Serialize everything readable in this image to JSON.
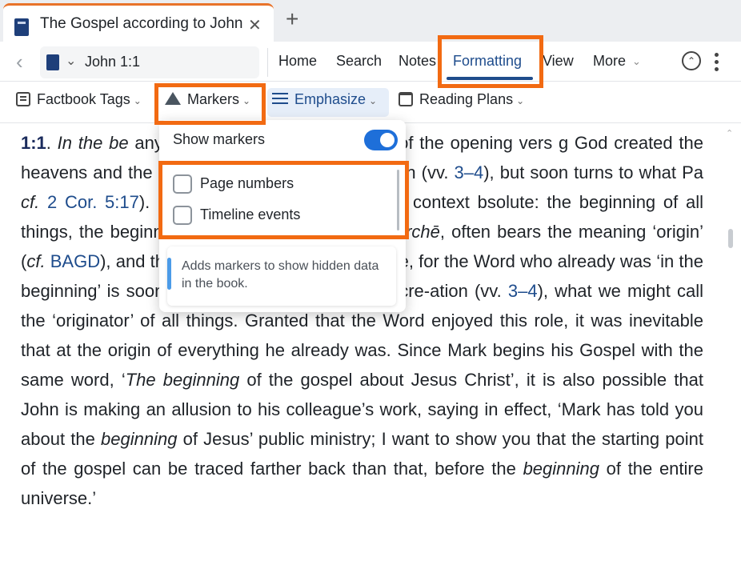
{
  "tab": {
    "title": "The Gospel according to John",
    "close": "✕",
    "add": "+"
  },
  "nav": {
    "back": "‹",
    "reference": "John 1:1",
    "menu": [
      "Home",
      "Search",
      "Notes",
      "Formatting",
      "View",
      "More"
    ],
    "active_menu": "Formatting"
  },
  "toolbar": {
    "factbook": "Factbook Tags",
    "markers": "Markers",
    "emphasize": "Emphasize",
    "reading_plans": "Reading Plans",
    "chevron": "⌄"
  },
  "dropdown": {
    "show_markers_label": "Show markers",
    "show_markers_on": true,
    "options": [
      {
        "label": "Page numbers",
        "checked": false
      },
      {
        "label": "Timeline events",
        "checked": false
      }
    ],
    "hint": "Adds markers to show hidden data in the book."
  },
  "body": {
    "verse": "1:1",
    "segments": [
      [
        ". ",
        "t"
      ],
      [
        "In the be",
        "i"
      ],
      [
        "                              any reader of the Old Testament of the opening vers                              g God created the heavens and the earth.’ Genesis b                             fers to creation (vv. ",
        "t"
      ],
      [
        "3–4",
        "l"
      ],
      [
        "), but soon turns to what Pa                          ",
        "t"
      ],
      [
        "cf.",
        "i"
      ],
      [
        " ",
        "t"
      ],
      [
        "2 Cor. 5:17",
        "l"
      ],
      [
        "). Both in Genesis and here, the context                        bsolute: the beginning of all things, the beginning o                        ord behind ‘beginning’, ",
        "t"
      ],
      [
        "archē",
        "i"
      ],
      [
        ", often bears the meaning ‘origin’ (",
        "t"
      ],
      [
        "cf.",
        "i"
      ],
      [
        " ",
        "t"
      ],
      [
        "BAGD",
        "l"
      ],
      [
        "), and there may be echoes of that here, for the Word who already was ‘in the beginning’ is soon shown to be God’s agent of cre-ation (vv. ",
        "t"
      ],
      [
        "3–4",
        "l"
      ],
      [
        "), what we might call the ‘originator’ of all things. Granted that the Word enjoyed this role, it was inevitable that at the origin of everything he already was. Since Mark begins his Gospel with the same word, ‘",
        "t"
      ],
      [
        "The beginning",
        "i"
      ],
      [
        " of the gospel about Jesus Christ’, it is also possible that John is making an allusion to his colleague’s work, saying in effect, ‘Mark has told you about the ",
        "t"
      ],
      [
        "beginning",
        "i"
      ],
      [
        " of Jesus’ public ministry; I want to show you that the starting point of the gospel can be traced farther back than that, before the ",
        "t"
      ],
      [
        "beginning",
        "i"
      ],
      [
        " of the entire universe.’",
        "t"
      ]
    ]
  },
  "colors": {
    "accent": "#1e4c8c",
    "highlight": "#f26a12",
    "toggle": "#1e6fd9"
  }
}
